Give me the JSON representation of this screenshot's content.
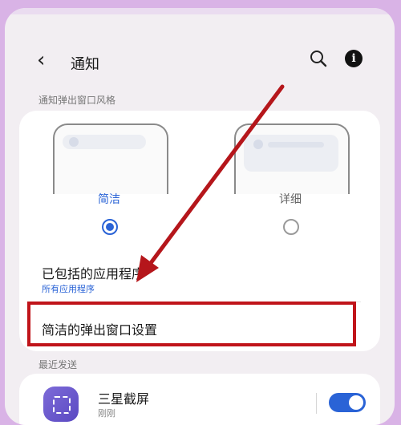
{
  "header": {
    "title": "通知",
    "back_icon": "chevron-left-icon",
    "search_icon": "search-icon",
    "info_icon": "info-icon"
  },
  "popup_style": {
    "section_label": "通知弹出窗口风格",
    "options": [
      {
        "label": "简洁",
        "selected": true,
        "color": "#2a63d6"
      },
      {
        "label": "详细",
        "selected": false,
        "color": "#666666"
      }
    ]
  },
  "included_apps": {
    "title": "已包括的应用程序",
    "subtitle": "所有应用程序"
  },
  "brief_popup_settings": {
    "title": "简洁的弹出窗口设置"
  },
  "recent": {
    "section_label": "最近发送",
    "items": [
      {
        "name": "三星截屏",
        "time": "刚刚",
        "enabled": true
      }
    ]
  },
  "colors": {
    "accent": "#2a63d6",
    "highlight_box": "#c0141a",
    "frame_border": "#d9b3e6"
  }
}
